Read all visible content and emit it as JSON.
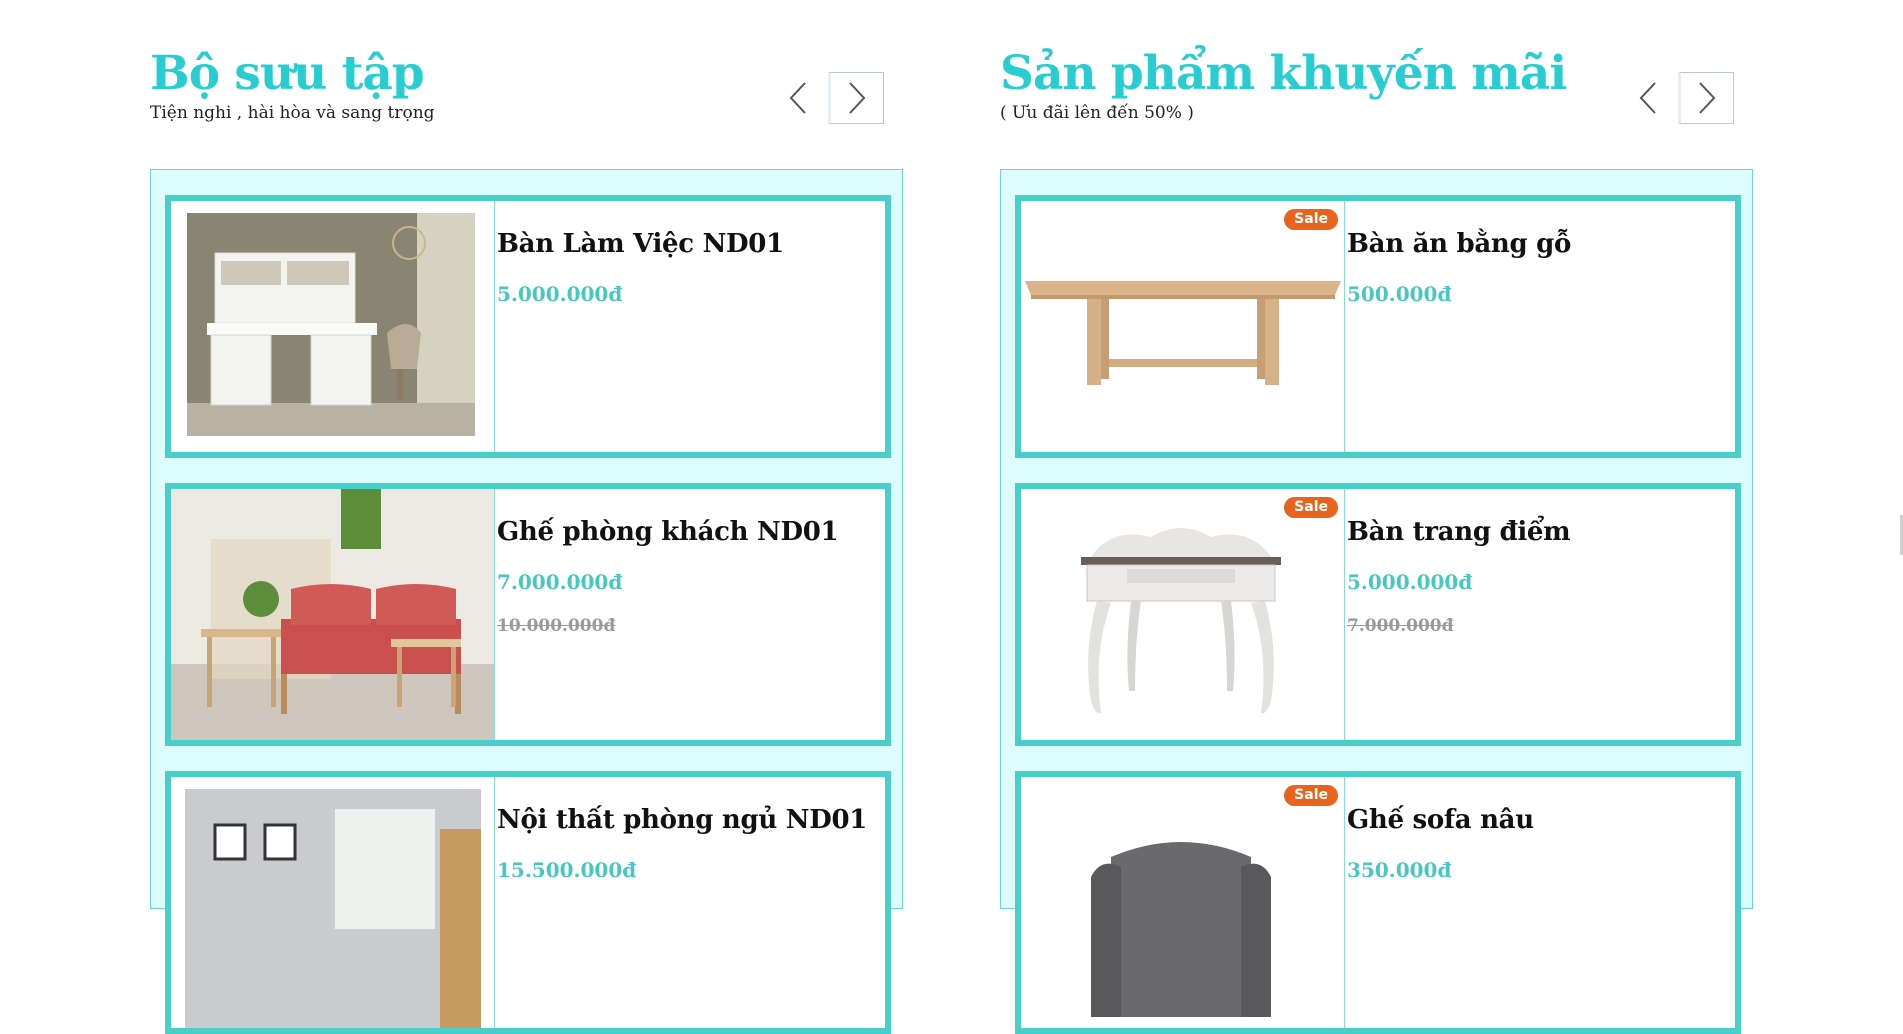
{
  "collection": {
    "title": "Bộ sưu tập",
    "subtitle": "Tiện nghi , hài hòa và sang trọng",
    "products": [
      {
        "name": "Bàn Làm Việc ND01",
        "price": "5.000.000đ",
        "old_price": ""
      },
      {
        "name": "Ghế phòng khách ND01",
        "price": "7.000.000đ",
        "old_price": "10.000.000đ"
      },
      {
        "name": "Nội thất phòng ngủ ND01",
        "price": "15.500.000đ",
        "old_price": ""
      }
    ]
  },
  "promotions": {
    "title": "Sản phẩm khuyến mãi",
    "subtitle": "( Ưu đãi lên đến 50% )",
    "sale_label": "Sale",
    "products": [
      {
        "name": "Bàn ăn bằng gỗ",
        "price": "500.000đ",
        "old_price": ""
      },
      {
        "name": "Bàn trang điểm",
        "price": "5.000.000đ",
        "old_price": "7.000.000đ"
      },
      {
        "name": "Ghế sofa nâu",
        "price": "350.000đ",
        "old_price": ""
      }
    ]
  },
  "icons": {
    "prev": "chevron-left-icon",
    "next": "chevron-right-icon"
  },
  "colors": {
    "accent": "#27cdd0",
    "border": "#48cfc9",
    "panel_bg": "#dcfdfb",
    "sale": "#e8641c",
    "price": "#48c6c4"
  }
}
